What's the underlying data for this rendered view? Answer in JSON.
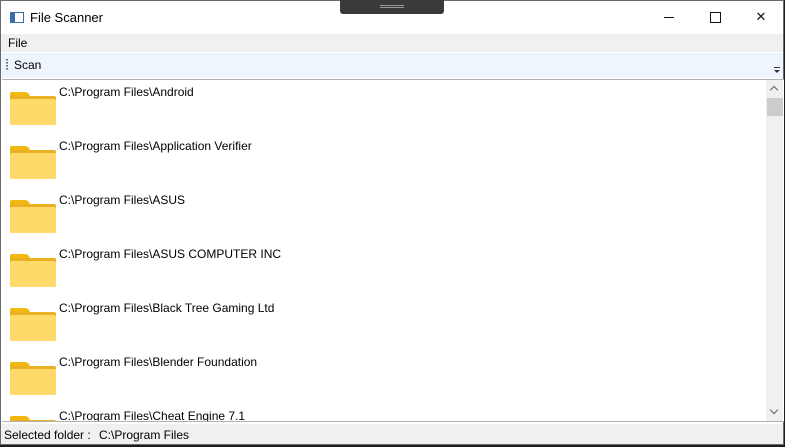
{
  "window": {
    "title": "File Scanner",
    "buttons": {
      "minimize": "minimize",
      "maximize": "maximize",
      "close": "✕"
    }
  },
  "menu": {
    "items": [
      {
        "label": "File"
      }
    ]
  },
  "toolbar": {
    "scan_label": "Scan"
  },
  "folders": [
    {
      "path": "C:\\Program Files\\Android",
      "icon": "folder-icon"
    },
    {
      "path": "C:\\Program Files\\Application Verifier",
      "icon": "folder-icon"
    },
    {
      "path": "C:\\Program Files\\ASUS",
      "icon": "folder-icon"
    },
    {
      "path": "C:\\Program Files\\ASUS COMPUTER INC",
      "icon": "folder-icon"
    },
    {
      "path": "C:\\Program Files\\Black Tree Gaming Ltd",
      "icon": "folder-icon"
    },
    {
      "path": "C:\\Program Files\\Blender Foundation",
      "icon": "folder-icon"
    },
    {
      "path": "C:\\Program Files\\Cheat Engine 7.1",
      "icon": "folder-icon"
    }
  ],
  "status": {
    "label": "Selected folder :",
    "value": "C:\\Program Files"
  },
  "colors": {
    "folder_front": "#ffd96a",
    "folder_back": "#e9b021",
    "toolbar_bg": "#eef5fd",
    "status_bg": "#f0f0f0"
  }
}
